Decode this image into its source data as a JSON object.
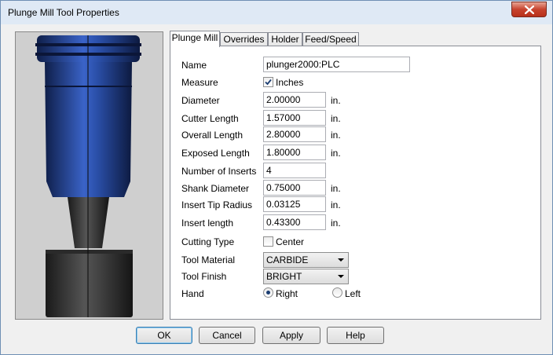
{
  "window": {
    "title": "Plunge Mill Tool Properties"
  },
  "tabs": [
    "Plunge Mill",
    "Overrides",
    "Holder",
    "Feed/Speed"
  ],
  "fields": {
    "name": {
      "label": "Name",
      "value": "plunger2000:PLC"
    },
    "measure": {
      "label": "Measure",
      "checkbox_label": "Inches",
      "checked": true
    },
    "diameter": {
      "label": "Diameter",
      "value": "2.00000",
      "unit": "in."
    },
    "cutter_length": {
      "label": "Cutter Length",
      "value": "1.57000",
      "unit": "in."
    },
    "overall_length": {
      "label": "Overall Length",
      "value": "2.80000",
      "unit": "in."
    },
    "exposed_length": {
      "label": "Exposed Length",
      "value": "1.80000",
      "unit": "in."
    },
    "number_of_inserts": {
      "label": "Number of Inserts",
      "value": "4"
    },
    "shank_diameter": {
      "label": "Shank Diameter",
      "value": "0.75000",
      "unit": "in."
    },
    "insert_tip_radius": {
      "label": "Insert Tip Radius",
      "value": "0.03125",
      "unit": "in."
    },
    "insert_length": {
      "label": "Insert length",
      "value": "0.43300",
      "unit": "in."
    },
    "cutting_type": {
      "label": "Cutting Type",
      "checkbox_label": "Center",
      "checked": false
    },
    "tool_material": {
      "label": "Tool Material",
      "value": "CARBIDE"
    },
    "tool_finish": {
      "label": "Tool Finish",
      "value": "BRIGHT"
    },
    "hand": {
      "label": "Hand",
      "options": [
        "Right",
        "Left"
      ],
      "selected": "Right"
    }
  },
  "buttons": {
    "ok": "OK",
    "cancel": "Cancel",
    "apply": "Apply",
    "help": "Help"
  },
  "icons": {
    "close": "close-icon",
    "check": "checkmark-icon",
    "preview": "tool-preview-image"
  },
  "colors": {
    "tool_blue": "#1f3f8a",
    "tool_dark": "#3a3a3a",
    "close_red": "#c7432e"
  }
}
